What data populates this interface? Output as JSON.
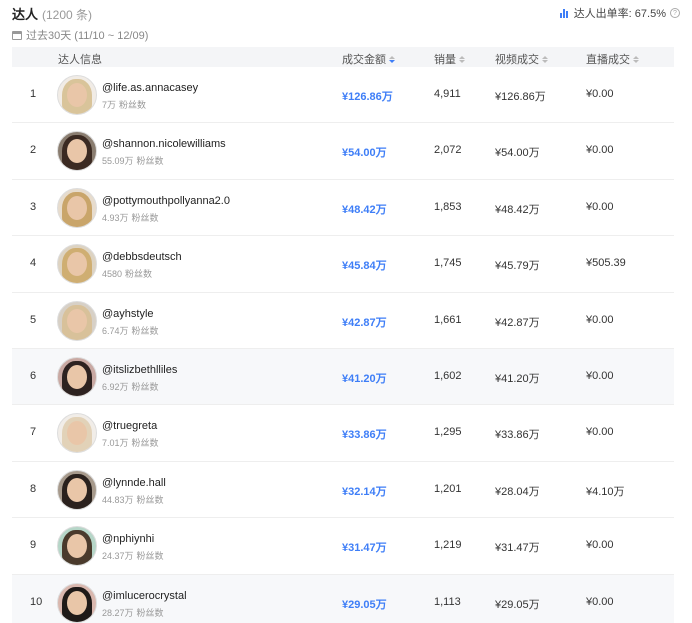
{
  "header": {
    "title": "达人",
    "count": "(1200 条)",
    "rate_label": "达人出单率: 67.5%",
    "period": "过去30天 (11/10 ~ 12/09)"
  },
  "columns": {
    "info": "达人信息",
    "gmv": "成交金额",
    "sales": "销量",
    "video": "视频成交",
    "live": "直播成交"
  },
  "colors": {
    "accent": "#3e7ef7",
    "header_bg": "#f4f5f7",
    "row_highlight": "#f7f8fa"
  },
  "rows": [
    {
      "rank": "1",
      "handle": "@life.as.annacasey",
      "fans": "7万",
      "fans_label": "粉丝数",
      "gmv": "¥126.86万",
      "sales": "4,911",
      "video": "¥126.86万",
      "live": "¥0.00"
    },
    {
      "rank": "2",
      "handle": "@shannon.nicolewilliams",
      "fans": "55.09万",
      "fans_label": "粉丝数",
      "gmv": "¥54.00万",
      "sales": "2,072",
      "video": "¥54.00万",
      "live": "¥0.00"
    },
    {
      "rank": "3",
      "handle": "@pottymouthpollyanna2.0",
      "fans": "4.93万",
      "fans_label": "粉丝数",
      "gmv": "¥48.42万",
      "sales": "1,853",
      "video": "¥48.42万",
      "live": "¥0.00"
    },
    {
      "rank": "4",
      "handle": "@debbsdeutsch",
      "fans": "4580",
      "fans_label": "粉丝数",
      "gmv": "¥45.84万",
      "sales": "1,745",
      "video": "¥45.79万",
      "live": "¥505.39"
    },
    {
      "rank": "5",
      "handle": "@ayhstyle",
      "fans": "6.74万",
      "fans_label": "粉丝数",
      "gmv": "¥42.87万",
      "sales": "1,661",
      "video": "¥42.87万",
      "live": "¥0.00"
    },
    {
      "rank": "6",
      "handle": "@itslizbethlliles",
      "fans": "6.92万",
      "fans_label": "粉丝数",
      "gmv": "¥41.20万",
      "sales": "1,602",
      "video": "¥41.20万",
      "live": "¥0.00"
    },
    {
      "rank": "7",
      "handle": "@truegreta",
      "fans": "7.01万",
      "fans_label": "粉丝数",
      "gmv": "¥33.86万",
      "sales": "1,295",
      "video": "¥33.86万",
      "live": "¥0.00"
    },
    {
      "rank": "8",
      "handle": "@lynnde.hall",
      "fans": "44.83万",
      "fans_label": "粉丝数",
      "gmv": "¥32.14万",
      "sales": "1,201",
      "video": "¥28.04万",
      "live": "¥4.10万"
    },
    {
      "rank": "9",
      "handle": "@nphiynhi",
      "fans": "24.37万",
      "fans_label": "粉丝数",
      "gmv": "¥31.47万",
      "sales": "1,219",
      "video": "¥31.47万",
      "live": "¥0.00"
    },
    {
      "rank": "10",
      "handle": "@imlucerocrystal",
      "fans": "28.27万",
      "fans_label": "粉丝数",
      "gmv": "¥29.05万",
      "sales": "1,113",
      "video": "¥29.05万",
      "live": "¥0.00"
    }
  ]
}
